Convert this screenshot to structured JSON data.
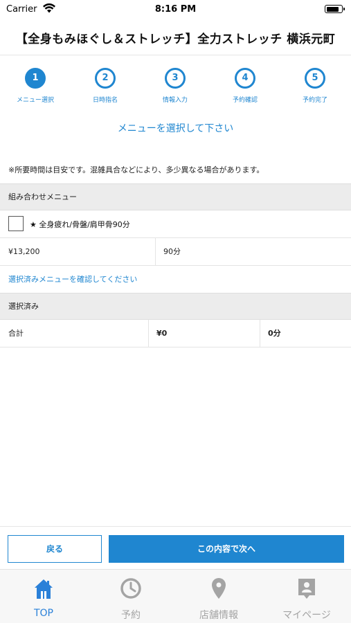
{
  "status_bar": {
    "carrier": "Carrier",
    "time": "8:16 PM"
  },
  "header": {
    "title": "【全身もみほぐし＆ストレッチ】全力ストレッチ 横浜元町"
  },
  "steps": [
    {
      "number": "1",
      "label": "メニュー選択",
      "active": true
    },
    {
      "number": "2",
      "label": "日時指名",
      "active": false
    },
    {
      "number": "3",
      "label": "情報入力",
      "active": false
    },
    {
      "number": "4",
      "label": "予約確認",
      "active": false
    },
    {
      "number": "5",
      "label": "予約完了",
      "active": false
    }
  ],
  "instruction": "メニューを選択して下さい",
  "note": "※所要時間は目安です。混雑具合などにより、多少異なる場合があります。",
  "combo_section": {
    "header": "組み合わせメニュー",
    "menu": {
      "name": "★ 全身疲れ/骨盤/肩甲骨90分",
      "checked": false,
      "price": "¥13,200",
      "duration": "90分"
    }
  },
  "confirm_link": "選択済みメニューを確認してください",
  "selected_section": {
    "header": "選択済み",
    "total_label": "合計",
    "total_price": "¥0",
    "total_duration": "0分"
  },
  "buttons": {
    "back": "戻る",
    "next": "この内容で次へ"
  },
  "tab_bar": [
    {
      "label": "TOP",
      "icon": "home-icon",
      "active": true
    },
    {
      "label": "予約",
      "icon": "clock-icon",
      "active": false
    },
    {
      "label": "店舗情報",
      "icon": "location-pin-icon",
      "active": false
    },
    {
      "label": "マイページ",
      "icon": "profile-card-icon",
      "active": false
    }
  ],
  "colors": {
    "accent": "#1f86d0",
    "tab_active": "#2a80d8",
    "tab_inactive": "#a4a4a4",
    "section_bg": "#ececec"
  }
}
